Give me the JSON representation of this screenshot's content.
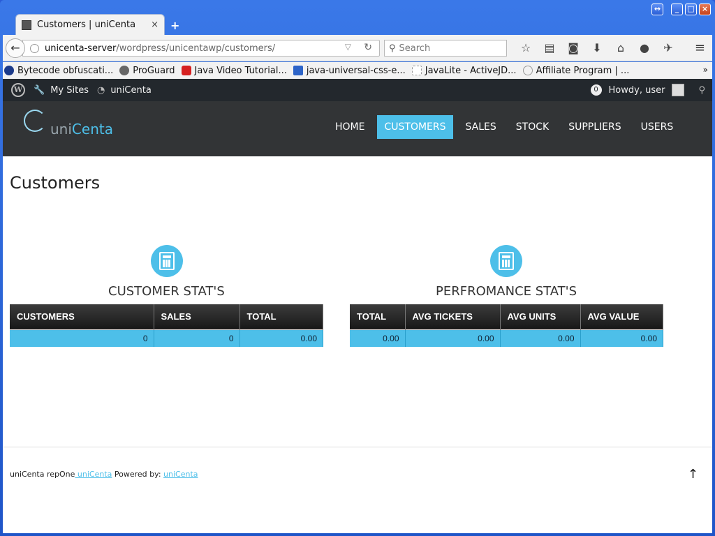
{
  "browser": {
    "tab_title": "Customers | uniCenta",
    "tab_close": "×",
    "new_tab": "+",
    "url_host": "unicenta-server",
    "url_path": "/wordpress/unicentawp/customers/",
    "search_placeholder": "Search",
    "bookmarks": [
      {
        "label": "Bytecode obfuscati...",
        "color": "#1b3a8a"
      },
      {
        "label": "ProGuard",
        "color": "#666666"
      },
      {
        "label": "Java Video Tutorial...",
        "color": "#d62020"
      },
      {
        "label": "java-universal-css-e...",
        "color": "#2d64c8"
      },
      {
        "label": "JavaLite - ActiveJD...",
        "color": "#cccccc"
      },
      {
        "label": "Affiliate Program | ...",
        "color": "#999999"
      }
    ],
    "bookmarks_more": "»"
  },
  "wp_admin_bar": {
    "my_sites": "My Sites",
    "site_name": "uniCenta",
    "comments_count": "0",
    "greeting": "Howdy, user"
  },
  "site": {
    "logo_uni": "uni",
    "logo_centa": "Centa",
    "nav": [
      {
        "label": "HOME",
        "active": false
      },
      {
        "label": "CUSTOMERS",
        "active": true
      },
      {
        "label": "SALES",
        "active": false
      },
      {
        "label": "STOCK",
        "active": false
      },
      {
        "label": "SUPPLIERS",
        "active": false
      },
      {
        "label": "USERS",
        "active": false
      }
    ],
    "accent_color": "#4dbfe9"
  },
  "page": {
    "title": "Customers",
    "customer_stats": {
      "title": "CUSTOMER STAT'S",
      "headers": [
        "CUSTOMERS",
        "SALES",
        "TOTAL"
      ],
      "values": [
        "0",
        "0",
        "0.00"
      ]
    },
    "performance_stats": {
      "title": "PERFROMANCE STAT'S",
      "headers": [
        "TOTAL",
        "AVG TICKETS",
        "AVG UNITS",
        "AVG VALUE"
      ],
      "values": [
        "0.00",
        "0.00",
        "0.00",
        "0.00"
      ]
    }
  },
  "footer": {
    "prefix": "uniCenta repOne",
    "link1": " uniCenta",
    "powered": " Powered by: ",
    "link2": "uniCenta",
    "back_to_top": "↑"
  }
}
